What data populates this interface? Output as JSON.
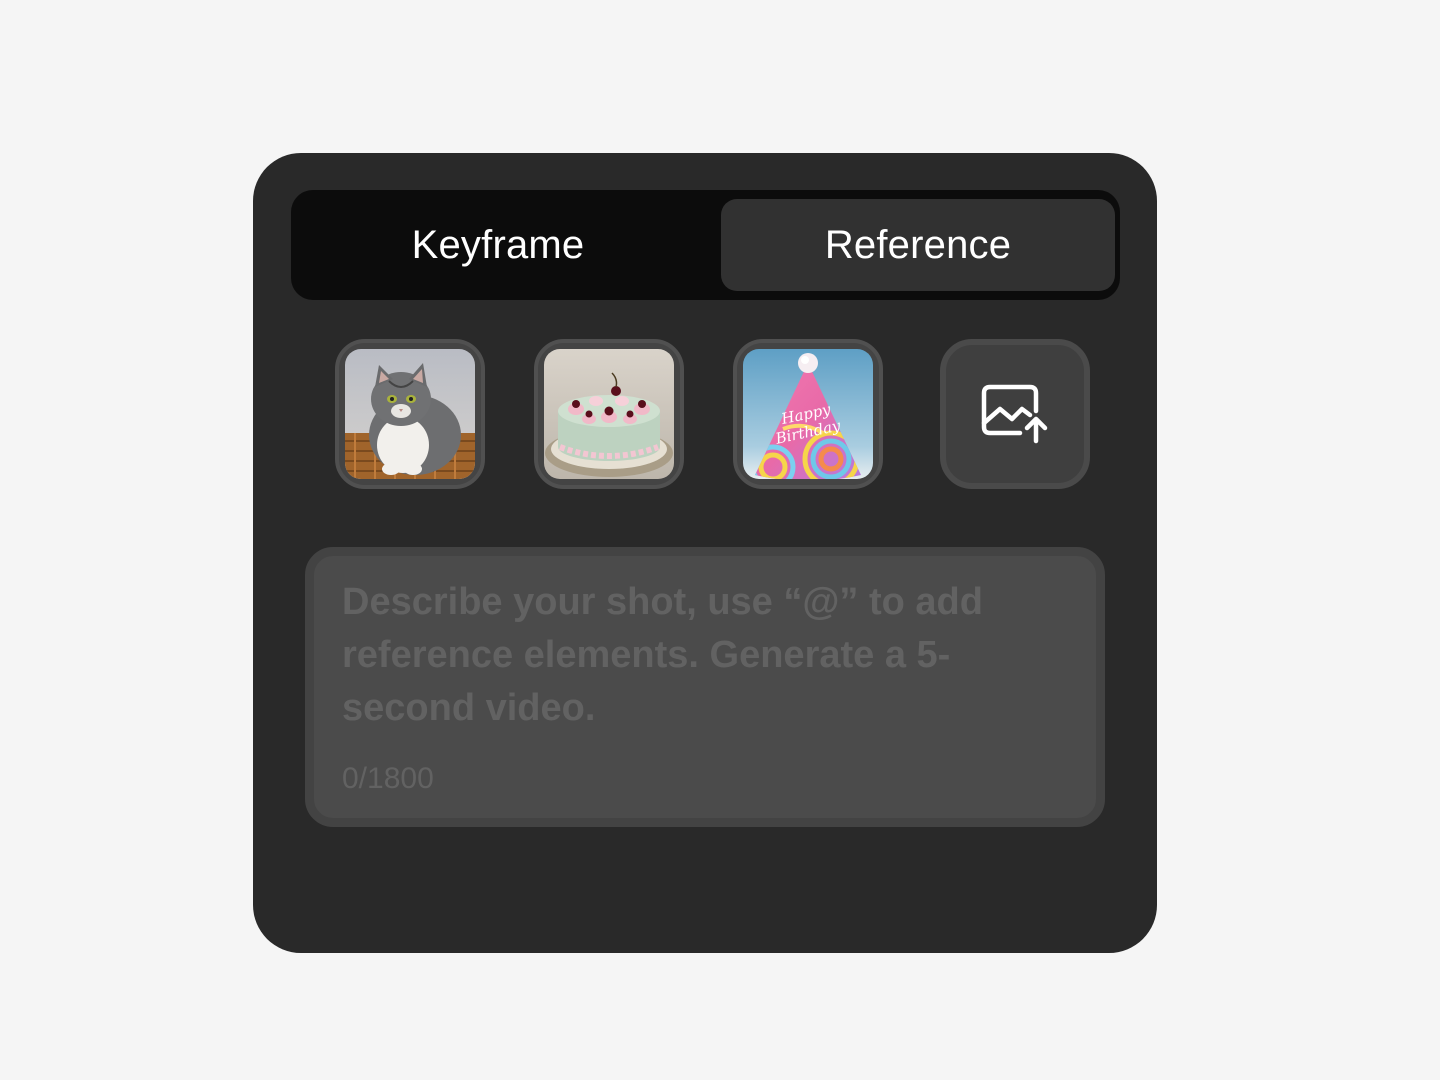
{
  "tabs": {
    "keyframe": "Keyframe",
    "reference": "Reference",
    "active": "reference"
  },
  "references": [
    {
      "name": "cat"
    },
    {
      "name": "cake"
    },
    {
      "name": "party-hat",
      "text_line1": "Happy",
      "text_line2": "Birthday"
    }
  ],
  "upload": {
    "icon": "image-upload-icon"
  },
  "prompt": {
    "placeholder": "Describe your shot, use “@” to add reference elements. Generate a 5-second video.",
    "value": "",
    "counter": "0/1800"
  }
}
